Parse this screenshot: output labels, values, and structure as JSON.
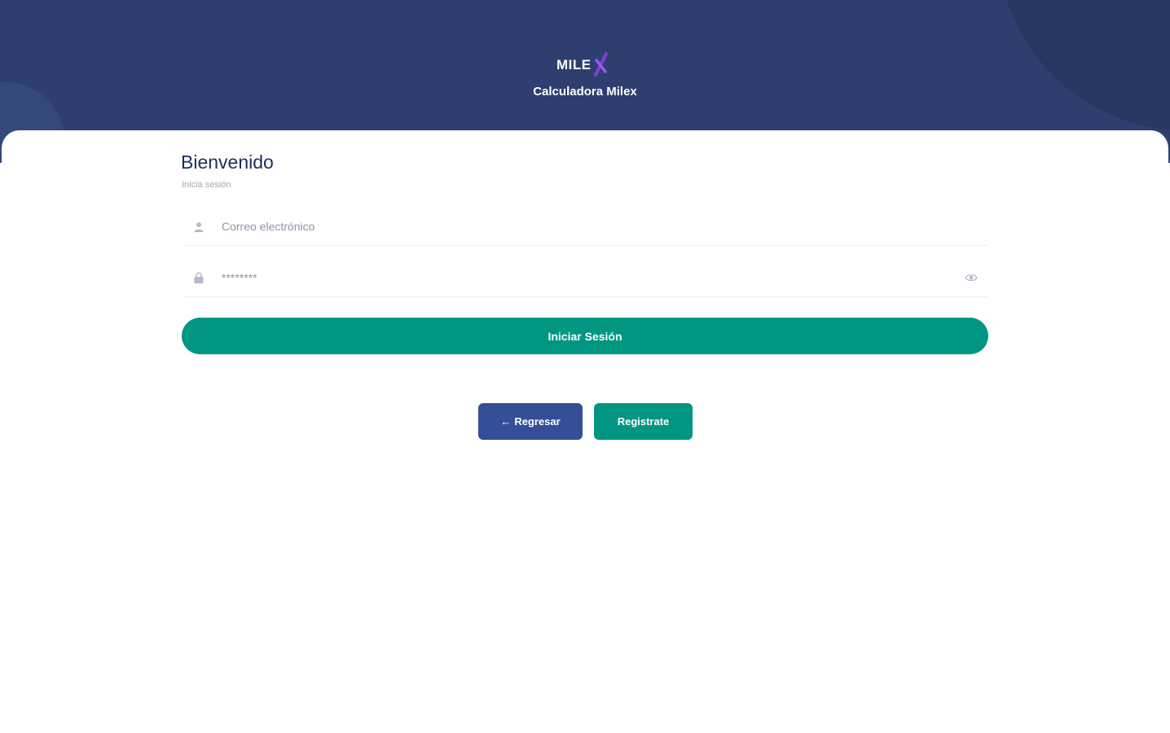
{
  "header": {
    "logo_text": "MILE",
    "app_title": "Calculadora Milex"
  },
  "login": {
    "title": "Bienvenido",
    "subtitle": "Inicia sesión",
    "email": {
      "placeholder": "Correo electrónico",
      "value": ""
    },
    "password": {
      "placeholder": "********",
      "value": ""
    },
    "submit_label": "Iniciar Sesión"
  },
  "actions": {
    "back_arrow": "←",
    "back_label": "Regresar",
    "register_label": "Registrate"
  },
  "colors": {
    "header_bg": "#2e3e6e",
    "primary_green": "#009682",
    "back_blue": "#344f98",
    "logo_accent": "#7b3fd8",
    "title_color": "#1f2d5a"
  },
  "icons": {
    "email_field": "user-icon",
    "password_field": "lock-icon",
    "toggle_password": "eye-icon",
    "logo_mark": "x-logo-icon"
  }
}
